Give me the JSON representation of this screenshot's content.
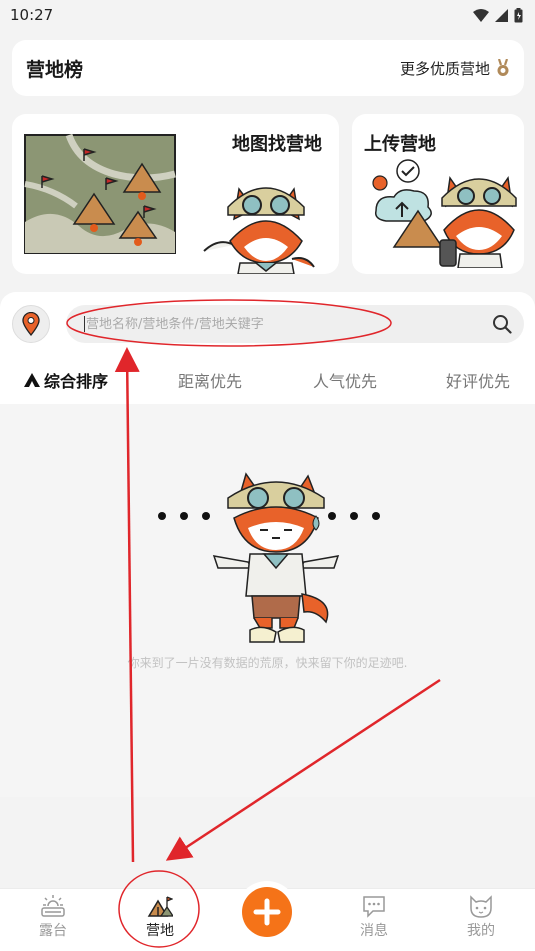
{
  "status_bar": {
    "time": "10:27"
  },
  "rank_card": {
    "title": "营地榜",
    "more_label": "更多优质营地"
  },
  "features": {
    "map_card": {
      "title": "地图找营地"
    },
    "upload_card": {
      "title": "上传营地"
    }
  },
  "search": {
    "placeholder": "营地名称/营地条件/营地关键字"
  },
  "sort_tabs": [
    {
      "label": "综合排序",
      "active": true
    },
    {
      "label": "距离优先"
    },
    {
      "label": "人气优先"
    },
    {
      "label": "好评优先"
    }
  ],
  "empty_state": {
    "message": "你来到了一片没有数据的荒原，快来留下你的足迹吧."
  },
  "bottom_nav": {
    "items": [
      {
        "label": "露台",
        "icon": "terrace-icon"
      },
      {
        "label": "营地",
        "icon": "campsite-icon",
        "active": true
      },
      {
        "label": "",
        "icon": "plus-icon"
      },
      {
        "label": "消息",
        "icon": "message-icon"
      },
      {
        "label": "我的",
        "icon": "cat-face-icon"
      }
    ]
  },
  "colors": {
    "accent_orange": "#f57318",
    "annotation_red": "#e0262b"
  }
}
